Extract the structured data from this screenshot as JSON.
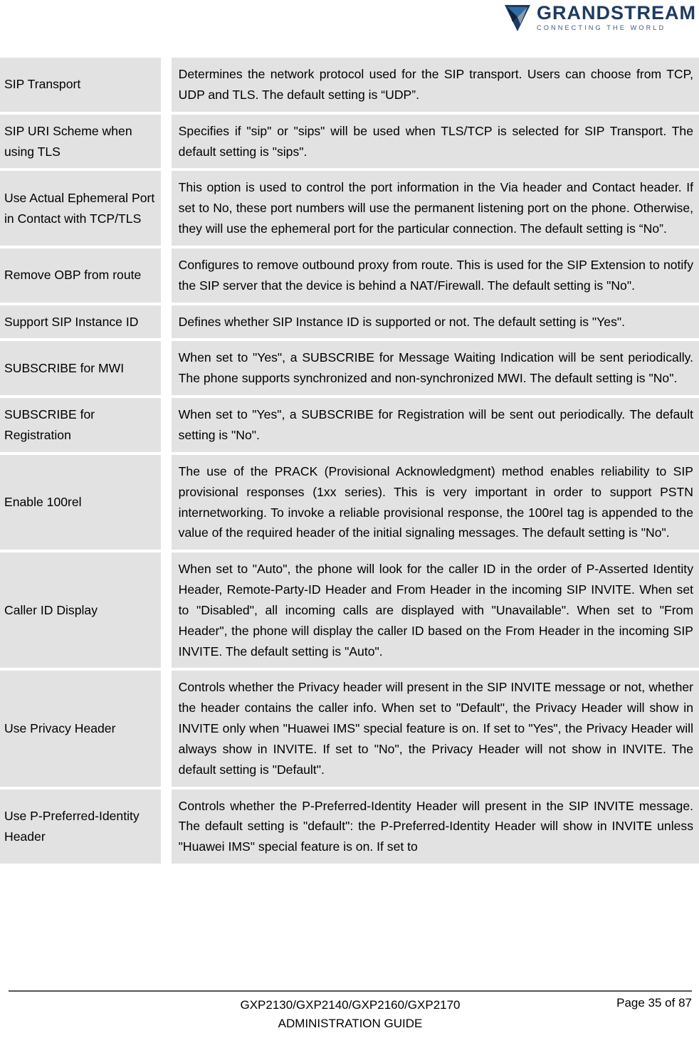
{
  "header": {
    "logo": {
      "icon": "grandstream-logo-mark",
      "wordmark": "GRANDSTREAM",
      "tagline": "CONNECTING THE WORLD",
      "brand_color": "#1f3a63",
      "tagline_color": "#3d5a83"
    }
  },
  "table": {
    "cell_background": "#e2e2e2",
    "rows": [
      {
        "label": "SIP Transport",
        "description": "Determines the network protocol used for the SIP transport. Users can choose from TCP, UDP and TLS. The default setting is “UDP”."
      },
      {
        "label": "SIP URI Scheme when using TLS",
        "description": "Specifies if \"sip\" or \"sips\" will be used when TLS/TCP is selected for SIP Transport. The default setting is \"sips\"."
      },
      {
        "label": "Use Actual Ephemeral Port in Contact with TCP/TLS",
        "description": "This option is used to control the port information in the Via header and Contact header. If set to No, these port numbers will use the permanent listening port on the phone. Otherwise, they will use the ephemeral port for the particular connection. The default setting is “No”."
      },
      {
        "label": "Remove OBP from route",
        "description": "Configures to remove outbound proxy from route. This is used for the SIP Extension to notify the SIP server that the device is behind a NAT/Firewall. The default setting is \"No\"."
      },
      {
        "label": "Support SIP Instance ID",
        "description": "Defines whether SIP Instance ID is supported or not. The default setting is \"Yes\"."
      },
      {
        "label": "SUBSCRIBE for MWI",
        "description": "When set to \"Yes\", a SUBSCRIBE for Message Waiting Indication will be sent periodically. The phone supports synchronized and non-synchronized MWI. The default setting is \"No\"."
      },
      {
        "label": "SUBSCRIBE for Registration",
        "description": "When set to \"Yes\", a SUBSCRIBE for Registration will be sent out periodically. The default setting is \"No\"."
      },
      {
        "label": "Enable 100rel",
        "description": "The use of the PRACK (Provisional Acknowledgment) method enables reliability to SIP provisional responses (1xx series). This is very important in order to support PSTN internetworking. To invoke a reliable provisional response, the 100rel tag is appended to the value of the required header of the initial signaling messages. The default setting is \"No\"."
      },
      {
        "label": "Caller ID Display",
        "description": "When set to \"Auto\", the phone will look for the caller ID in the order of P-Asserted Identity Header, Remote-Party-ID Header and From Header in the incoming SIP INVITE. When set to \"Disabled\", all incoming calls are displayed with \"Unavailable\". When set to \"From Header\", the phone will display the caller ID based on the From Header in the incoming SIP INVITE. The default setting is \"Auto\"."
      },
      {
        "label": "Use Privacy Header",
        "description": "Controls whether the Privacy header will present in the SIP INVITE message or not, whether the header contains the caller info. When set to \"Default\", the Privacy Header will show in INVITE only when \"Huawei IMS\" special feature is on. If set to \"Yes\", the Privacy Header will always show in INVITE. If set to \"No\", the Privacy Header will not show in INVITE. The default setting is \"Default\"."
      },
      {
        "label": "Use P-Preferred-Identity Header",
        "description": "Controls whether the P-Preferred-Identity Header will present in the SIP INVITE message. The default setting is \"default\": the P-Preferred-Identity Header will show in INVITE unless \"Huawei IMS\" special feature is on. If set to"
      }
    ]
  },
  "footer": {
    "product_line": "GXP2130/GXP2140/GXP2160/GXP2170",
    "guide_line": "ADMINISTRATION GUIDE",
    "page_label": "Page 35 of 87"
  }
}
